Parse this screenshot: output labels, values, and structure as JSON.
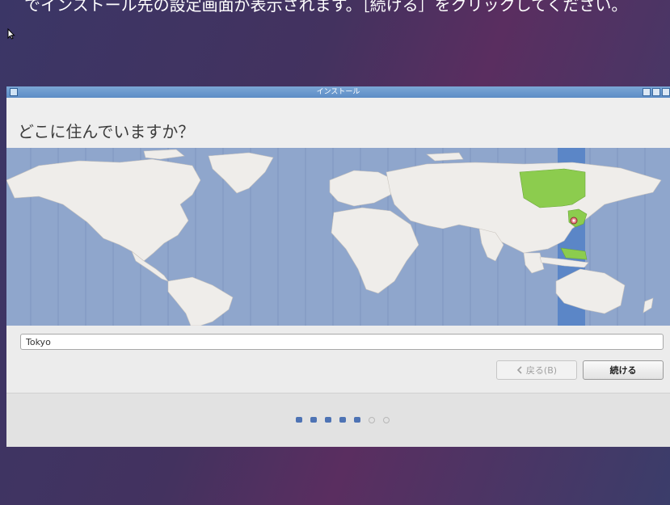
{
  "caption": "でインストール先の設定画面が表示されます。［続ける］をクリックしてください。",
  "window": {
    "title": "インストール",
    "heading": "どこに住んでいますか？"
  },
  "timezone": {
    "value": "Tokyo"
  },
  "buttons": {
    "back_label": "戻る(B)",
    "next_label": "続ける"
  },
  "progress": {
    "total_steps": 7,
    "completed_steps": 5
  },
  "icons": {
    "back_chevron": "chevron-left-icon",
    "location_marker": "map-pin-icon"
  },
  "colors": {
    "accent": "#4e73b4",
    "selected_region": "#8ccc4e",
    "timezone_band": "#5b86c7",
    "ocean": "#8fa6cc"
  }
}
